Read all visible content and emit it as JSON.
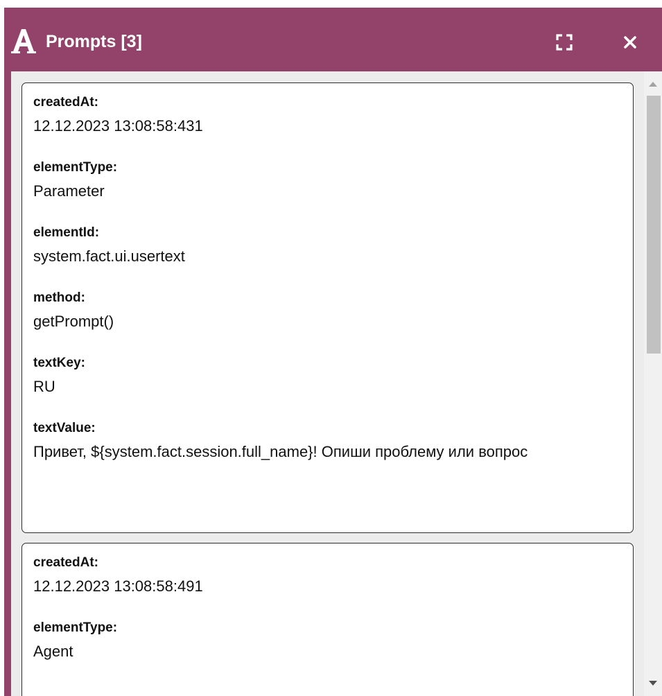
{
  "window": {
    "title": "Prompts [3]",
    "logo_icon": "letter-a-logo",
    "accent_color": "#93436a"
  },
  "prompts": [
    {
      "fields": [
        {
          "label": "createdAt:",
          "value": "12.12.2023 13:08:58:431"
        },
        {
          "label": "elementType:",
          "value": "Parameter"
        },
        {
          "label": "elementId:",
          "value": "system.fact.ui.usertext"
        },
        {
          "label": "method:",
          "value": "getPrompt()"
        },
        {
          "label": "textKey:",
          "value": "RU"
        },
        {
          "label": "textValue:",
          "value": "Привет, ${system.fact.session.full_name}! Опиши проблему или вопрос"
        }
      ]
    },
    {
      "fields": [
        {
          "label": "createdAt:",
          "value": "12.12.2023 13:08:58:491"
        },
        {
          "label": "elementType:",
          "value": "Agent"
        }
      ]
    }
  ]
}
